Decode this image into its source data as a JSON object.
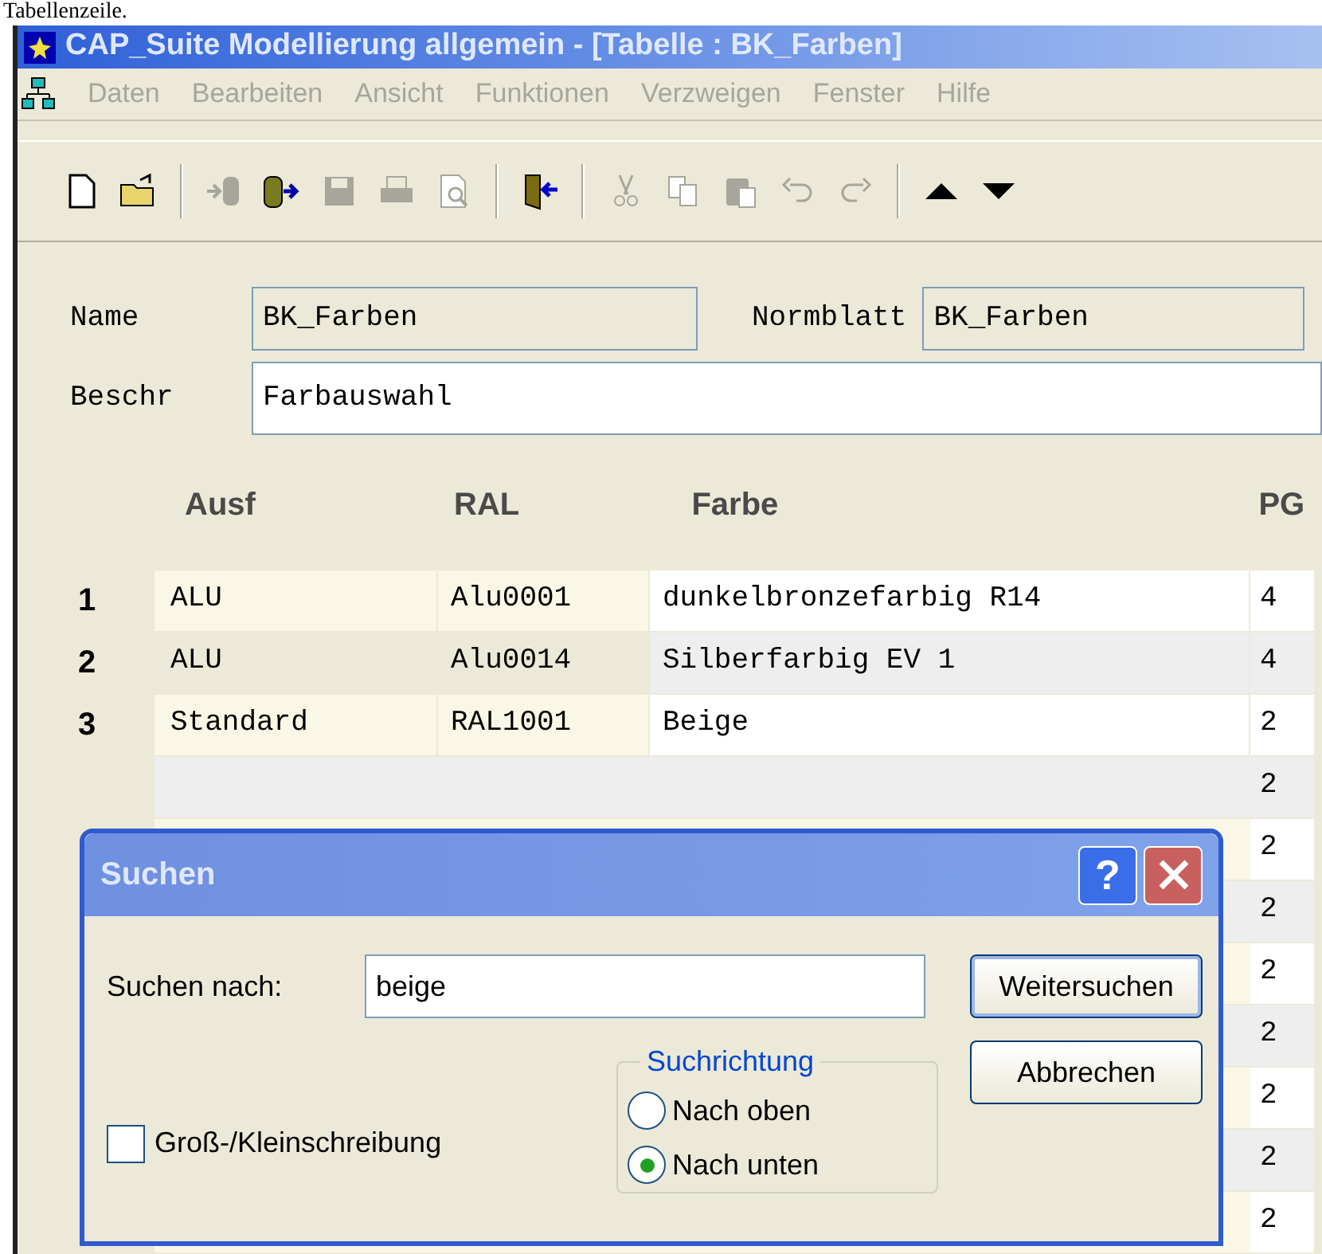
{
  "document_text": "Tabellenzeile.",
  "window": {
    "title": "CAP_Suite Modellierung allgemein - [Tabelle : BK_Farben]"
  },
  "menu": [
    {
      "label": "Daten",
      "disabled": true
    },
    {
      "label": "Bearbeiten",
      "disabled": true
    },
    {
      "label": "Ansicht",
      "disabled": true
    },
    {
      "label": "Funktionen",
      "disabled": true
    },
    {
      "label": "Verzweigen",
      "disabled": true
    },
    {
      "label": "Fenster",
      "disabled": true
    },
    {
      "label": "Hilfe",
      "disabled": true
    }
  ],
  "toolbar": [
    {
      "kind": "new",
      "disabled": false
    },
    {
      "kind": "open",
      "disabled": false
    },
    {
      "kind": "sep"
    },
    {
      "kind": "import",
      "disabled": true
    },
    {
      "kind": "export",
      "disabled": false
    },
    {
      "kind": "save",
      "disabled": true
    },
    {
      "kind": "print",
      "disabled": true
    },
    {
      "kind": "preview",
      "disabled": true
    },
    {
      "kind": "sep"
    },
    {
      "kind": "exit",
      "disabled": false
    },
    {
      "kind": "sep"
    },
    {
      "kind": "cut",
      "disabled": true
    },
    {
      "kind": "copy",
      "disabled": true
    },
    {
      "kind": "paste",
      "disabled": true
    },
    {
      "kind": "undo",
      "disabled": true
    },
    {
      "kind": "redo",
      "disabled": true
    },
    {
      "kind": "sep"
    },
    {
      "kind": "up",
      "disabled": false
    },
    {
      "kind": "down",
      "disabled": false
    }
  ],
  "form": {
    "name_label": "Name",
    "name_value": "BK_Farben",
    "normblatt_label": "Normblatt",
    "normblatt_value": "BK_Farben",
    "beschr_label": "Beschr",
    "beschr_value": "Farbauswahl"
  },
  "table": {
    "columns": [
      "Ausf",
      "RAL",
      "Farbe",
      "PG"
    ],
    "rows": [
      {
        "number": "1",
        "ausf": "ALU",
        "ral": "Alu0001",
        "farbe": "dunkelbronzefarbig R14",
        "pg": "4"
      },
      {
        "number": "2",
        "ausf": "ALU",
        "ral": "Alu0014",
        "farbe": "Silberfarbig EV 1",
        "pg": "4"
      },
      {
        "number": "3",
        "ausf": "Standard",
        "ral": "RAL1001",
        "farbe": "Beige",
        "pg": "2"
      },
      {
        "pg": "2"
      },
      {
        "pg": "2"
      },
      {
        "pg": "2"
      },
      {
        "pg": "2"
      },
      {
        "pg": "2"
      },
      {
        "pg": "2"
      },
      {
        "pg": "2"
      },
      {
        "pg": "2"
      }
    ]
  },
  "dialog": {
    "title": "Suchen",
    "help": "?",
    "search_label": "Suchen nach:",
    "search_value": "beige",
    "find_next": "Weitersuchen",
    "cancel": "Abbrechen",
    "match_case": {
      "label": "Groß-/Kleinschreibung",
      "checked": false
    },
    "direction": {
      "title": "Suchrichtung",
      "options": [
        {
          "label": "Nach oben",
          "selected": false
        },
        {
          "label": "Nach unten",
          "selected": true
        }
      ]
    }
  }
}
